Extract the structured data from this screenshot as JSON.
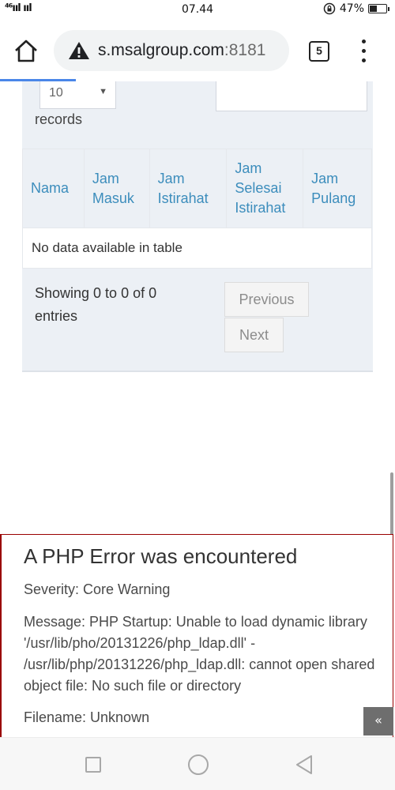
{
  "status_bar": {
    "network": "⁴⁶ııl ııl",
    "time": "07.44",
    "alarm_icon": "lock-rotation-icon",
    "battery": "47%",
    "battery_level": 0.47
  },
  "browser": {
    "url_host": "s.msalgroup.com",
    "url_port": ":8181",
    "tab_count": "5",
    "icons": [
      "home-icon",
      "warning-icon",
      "tab-switcher-icon",
      "overflow-menu-icon"
    ]
  },
  "table_controls": {
    "length_value": "10",
    "length_suffix": "records",
    "search_value": ""
  },
  "table": {
    "columns": [
      {
        "line1": "Nama",
        "line2": "",
        "line3": ""
      },
      {
        "line1": "Jam",
        "line2": "Masuk",
        "line3": ""
      },
      {
        "line1": "Jam",
        "line2": "Istirahat",
        "line3": ""
      },
      {
        "line1": "Jam",
        "line2": "Selesai",
        "line3": "Istirahat"
      },
      {
        "line1": "Jam",
        "line2": "Pulang",
        "line3": ""
      }
    ],
    "empty_message": "No data available in table"
  },
  "pagination": {
    "info": "Showing 0 to 0 of 0 entries",
    "previous_label": "Previous",
    "next_label": "Next"
  },
  "php_error": {
    "title": "A PHP Error was encountered",
    "severity": "Severity: Core Warning",
    "message": "Message: PHP Startup: Unable to load dynamic library '/usr/lib/pho/20131226/php_ldap.dll' - /usr/lib/php/20131226/php_ldap.dll: cannot open shared object file: No such file or directory",
    "filename": "Filename: Unknown"
  },
  "back_to_top": "«",
  "colors": {
    "link_blue": "#3c8dbc",
    "panel_bg": "#ecf0f5",
    "error_border": "#990000",
    "progress_blue": "#4a86e8"
  }
}
